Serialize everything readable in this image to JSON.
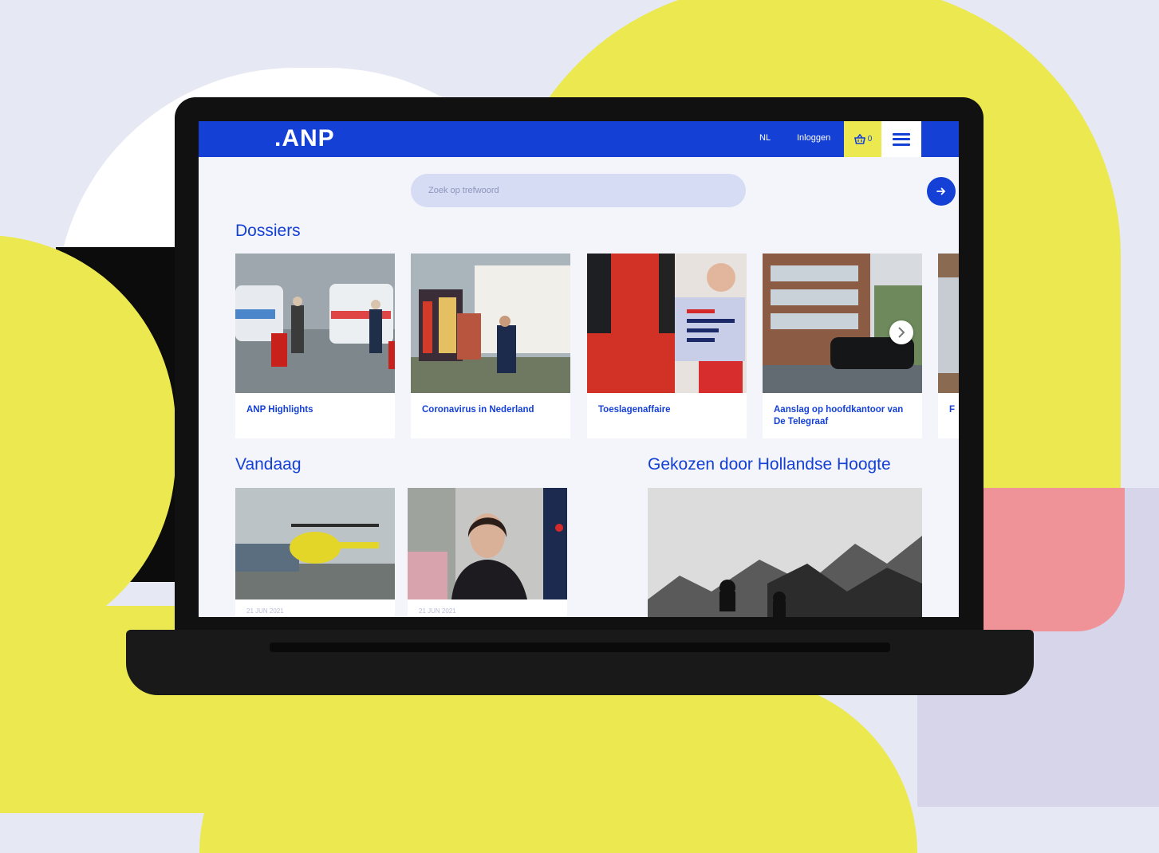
{
  "header": {
    "logo": ".ANP",
    "lang": "NL",
    "login": "Inloggen",
    "cart_count": "0",
    "cart_icon": "shopping-basket-icon",
    "menu_icon": "hamburger-menu-icon"
  },
  "search": {
    "placeholder": "Zoek op trefwoord",
    "button_icon": "arrow-right-icon"
  },
  "dossiers": {
    "title": "Dossiers",
    "items": [
      {
        "label": "ANP Highlights"
      },
      {
        "label": "Coronavirus in Nederland"
      },
      {
        "label": "Toeslagenaffaire"
      },
      {
        "label": "Aanslag op hoofdkantoor van De Telegraaf"
      },
      {
        "label": "F"
      }
    ],
    "next_icon": "chevron-right-icon"
  },
  "vandaag": {
    "title": "Vandaag",
    "items": [
      {
        "date": "21 JUN 2021"
      },
      {
        "date": "21 JUN 2021"
      }
    ]
  },
  "gekozen": {
    "title": "Gekozen door Hollandse Hoogte"
  },
  "colors": {
    "brand_blue": "#1440d6",
    "accent_yellow": "#ebe94f",
    "accent_pink": "#ef9398"
  }
}
